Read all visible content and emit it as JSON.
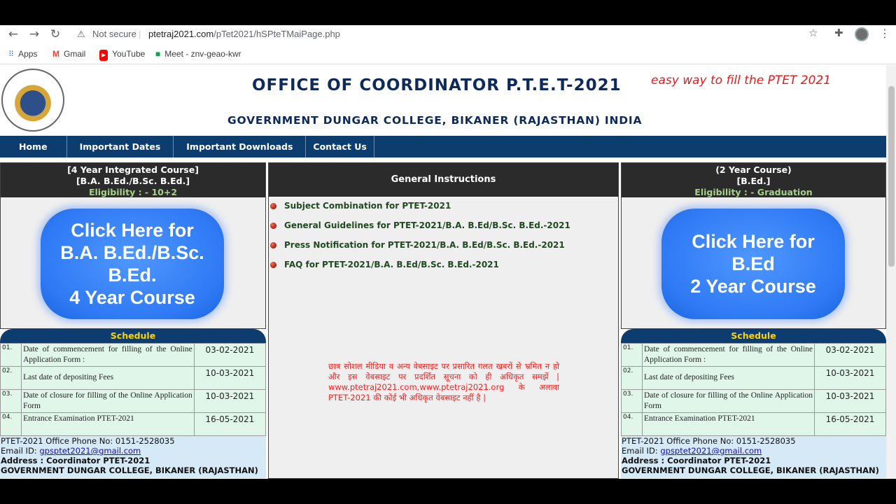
{
  "browser": {
    "security_label": "Not secure",
    "url_host": "ptetraj2021.com",
    "url_path": "/pTet2021/hSPteTMaiPage.php",
    "bookmarks": [
      "Apps",
      "Gmail",
      "YouTube",
      "Meet - znv-geao-kwr"
    ]
  },
  "header": {
    "title": "OFFICE OF COORDINATOR P.T.E.T-2021",
    "annotation": "easy way to fill the PTET 2021",
    "subtitle": "GOVERNMENT DUNGAR COLLEGE, BIKANER (RAJASTHAN) INDIA"
  },
  "nav": [
    "Home",
    "Important Dates",
    "Important Downloads",
    "Contact Us"
  ],
  "left": {
    "head_line1": "[4 Year Integrated Course]",
    "head_line2": "[B.A. B.Ed./B.Sc. B.Ed.]",
    "eligibility": "Eligibility : - 10+2",
    "banner_lines": [
      "Click Here for",
      "B.A. B.Ed./B.Sc.",
      "B.Ed.",
      "4 Year Course"
    ]
  },
  "right": {
    "head_line1": "(2 Year Course)",
    "head_line2": "[B.Ed.]",
    "eligibility": "Eligibility : - Graduation",
    "banner_lines": [
      "Click Here for",
      "B.Ed",
      "2 Year Course"
    ]
  },
  "schedule": {
    "title": "Schedule",
    "rows": [
      {
        "no": "01.",
        "desc": "Date of commencement for filling of the Online Application Form :",
        "date": "03-02-2021"
      },
      {
        "no": "02.",
        "desc": "Last date of depositing Fees",
        "date": "10-03-2021"
      },
      {
        "no": "03.",
        "desc": "Date of closure for filling of the Online Application Form",
        "date": "10-03-2021"
      },
      {
        "no": "04.",
        "desc": "Entrance Examination PTET-2021",
        "date": "16-05-2021"
      }
    ]
  },
  "contact": {
    "phone": "PTET-2021 Office Phone No: 0151-2528035",
    "email_label": "Email ID:",
    "email": "gpsptet2021@gmail.com",
    "address_label": "Address : Coordinator PTET-2021",
    "address_line": "GOVERNMENT DUNGAR COLLEGE, BIKANER (RAJASTHAN)"
  },
  "instructions": {
    "title": "General Instructions",
    "items": [
      "Subject Combination for PTET-2021",
      "General Guidelines for PTET-2021/B.A. B.Ed/B.Sc. B.Ed.-2021",
      "Press Notification for PTET-2021/B.A. B.Ed/B.Sc. B.Ed.-2021",
      "FAQ for PTET-2021/B.A. B.Ed/B.Sc. B.Ed.-2021"
    ],
    "notice": "छात्र सोशल मीडिया व अन्य वेबसाइट पर प्रसारित गलत खबरों से भ्रमित न हो और इस वेबसाइट पर प्रदर्शित सूचना को ही अधिकृत समझें | www.ptetraj2021.com,www.ptetraj2021.org के अलावा PTET-2021 की कोई भी अधिकृत वेबसाइट नहीं है |"
  }
}
